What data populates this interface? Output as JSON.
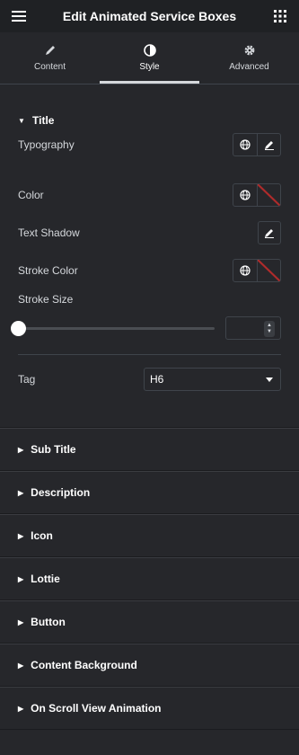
{
  "header": {
    "title": "Edit Animated Service Boxes"
  },
  "tabs": [
    {
      "label": "Content",
      "icon": "pencil-icon"
    },
    {
      "label": "Style",
      "icon": "contrast-icon",
      "active": true
    },
    {
      "label": "Advanced",
      "icon": "gear-icon"
    }
  ],
  "title_section": {
    "heading": "Title",
    "typography_label": "Typography",
    "color_label": "Color",
    "text_shadow_label": "Text Shadow",
    "stroke_color_label": "Stroke Color",
    "stroke_size_label": "Stroke Size",
    "stroke_size_value": "",
    "stroke_size_position": 0,
    "tag_label": "Tag",
    "tag_value": "H6"
  },
  "sections": [
    {
      "label": "Sub Title"
    },
    {
      "label": "Description"
    },
    {
      "label": "Icon"
    },
    {
      "label": "Lottie"
    },
    {
      "label": "Button"
    },
    {
      "label": "Content Background"
    },
    {
      "label": "On Scroll View Animation"
    }
  ],
  "colors": {
    "accent": "#d5d8dc",
    "background": "#26272b",
    "header": "#1f2124",
    "reset_slash": "#b22b2b"
  }
}
